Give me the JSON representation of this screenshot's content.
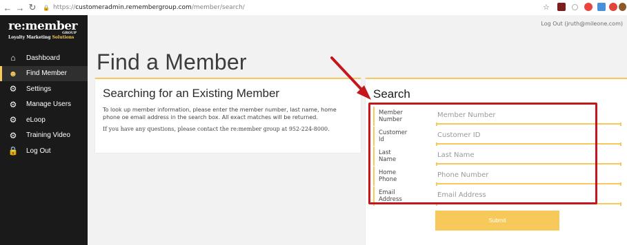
{
  "browser": {
    "url_prefix": "https://",
    "url_host": "customeradmin.remembergroup.com",
    "url_path": "/member/search/"
  },
  "sidebar": {
    "logo": {
      "main": "re:member",
      "group": "GROUP",
      "sub_a": "Loyalty Marketing",
      "sub_b": "Solutions"
    },
    "items": [
      {
        "label": "Dashboard",
        "icon": "home-icon"
      },
      {
        "label": "Find Member",
        "icon": "users-icon"
      },
      {
        "label": "Settings",
        "icon": "gear-icon"
      },
      {
        "label": "Manage Users",
        "icon": "gear-icon"
      },
      {
        "label": "eLoop",
        "icon": "gear-icon"
      },
      {
        "label": "Training Video",
        "icon": "gear-icon"
      },
      {
        "label": "Log Out",
        "icon": "lock-icon"
      }
    ]
  },
  "header": {
    "logout": "Log Out (jruth@mileone.com)"
  },
  "page": {
    "title": "Find a Member"
  },
  "info_card": {
    "title": "Searching for an Existing Member",
    "line1": "To look up member information, please enter the member number, last name, home",
    "line2": "phone oe email address in the search box. All exact matches will be returned.",
    "contact": "If you have any questions, please contact the re:member group at 952-224-8000."
  },
  "search_card": {
    "title": "Search",
    "fields": [
      {
        "label_a": "Member",
        "label_b": "Number",
        "value": "",
        "placeholder": "Member Number"
      },
      {
        "label_a": "Customer",
        "label_b": "Id",
        "value": "",
        "placeholder": "Customer ID"
      },
      {
        "label_a": "Last",
        "label_b": "Name",
        "value": "",
        "placeholder": "Last Name"
      },
      {
        "label_a": "Home",
        "label_b": "Phone",
        "value": "",
        "placeholder": "Phone Number"
      },
      {
        "label_a": "Email",
        "label_b": "Address",
        "value": "",
        "placeholder": "Email Address"
      }
    ],
    "submit_label": "Submit"
  },
  "colors": {
    "accent": "#f7c95a",
    "sidebar": "#1a1a1a",
    "annotation": "#c5161b"
  }
}
